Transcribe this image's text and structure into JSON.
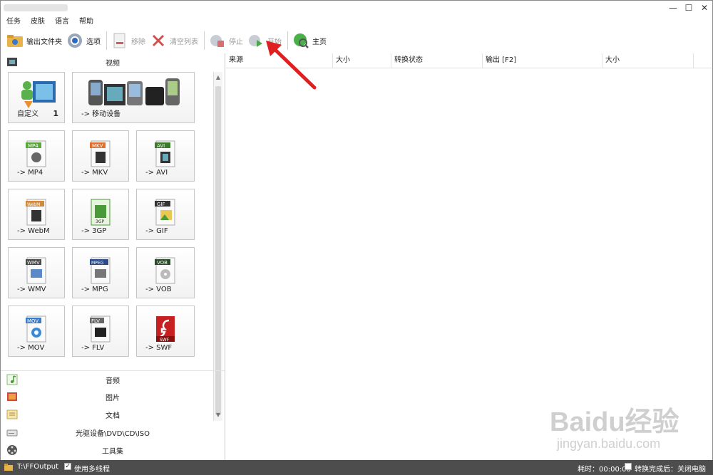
{
  "window": {
    "controls": {
      "minimize": "—",
      "maximize": "☐",
      "close": "✕"
    }
  },
  "menu": [
    "任务",
    "皮肤",
    "语言",
    "帮助"
  ],
  "toolbar": {
    "output_folder": "输出文件夹",
    "options": "选项",
    "remove": "移除",
    "clear_list": "清空列表",
    "stop": "停止",
    "start": "开始",
    "home": "主页"
  },
  "left": {
    "video_header": "视频",
    "tiles": [
      {
        "label": "自定义",
        "count": "1"
      },
      {
        "label": "-> 移动设备"
      },
      {
        "label": "-> MP4",
        "format": "MP4",
        "color": "#5aa83a"
      },
      {
        "label": "-> MKV",
        "format": "MKV",
        "color": "#e0702a"
      },
      {
        "label": "-> AVI",
        "format": "AVI",
        "color": "#3a7a2a"
      },
      {
        "label": "-> WebM",
        "format": "WebM",
        "color": "#d08a3a"
      },
      {
        "label": "-> 3GP",
        "format": "3GP",
        "color": "#4a9a3a"
      },
      {
        "label": "-> GIF",
        "format": "GIF",
        "color": "#333333"
      },
      {
        "label": "-> WMV",
        "format": "WMV",
        "color": "#4a4a4a"
      },
      {
        "label": "-> MPG",
        "format": "MPEG",
        "color": "#2a4a8a"
      },
      {
        "label": "-> VOB",
        "format": "VOB",
        "color": "#2a4a2a"
      },
      {
        "label": "-> MOV",
        "format": "MOV",
        "color": "#3a7ac8"
      },
      {
        "label": "-> FLV",
        "format": "FLV",
        "color": "#666666"
      },
      {
        "label": "-> SWF",
        "format": "SWF",
        "color": "#c82020"
      }
    ],
    "categories": [
      "音频",
      "图片",
      "文档",
      "光驱设备\\DVD\\CD\\ISO",
      "工具集"
    ]
  },
  "table": {
    "columns": [
      "来源",
      "大小",
      "转换状态",
      "输出 [F2]",
      "大小"
    ]
  },
  "status": {
    "path": "T:\\FFOutput",
    "multithread": "使用多线程",
    "time_label": "耗时：00:00:00",
    "after_label": "转换完成后：关闭电脑"
  },
  "watermark": {
    "logo": "Baidu经验",
    "url": "jingyan.baidu.com"
  }
}
